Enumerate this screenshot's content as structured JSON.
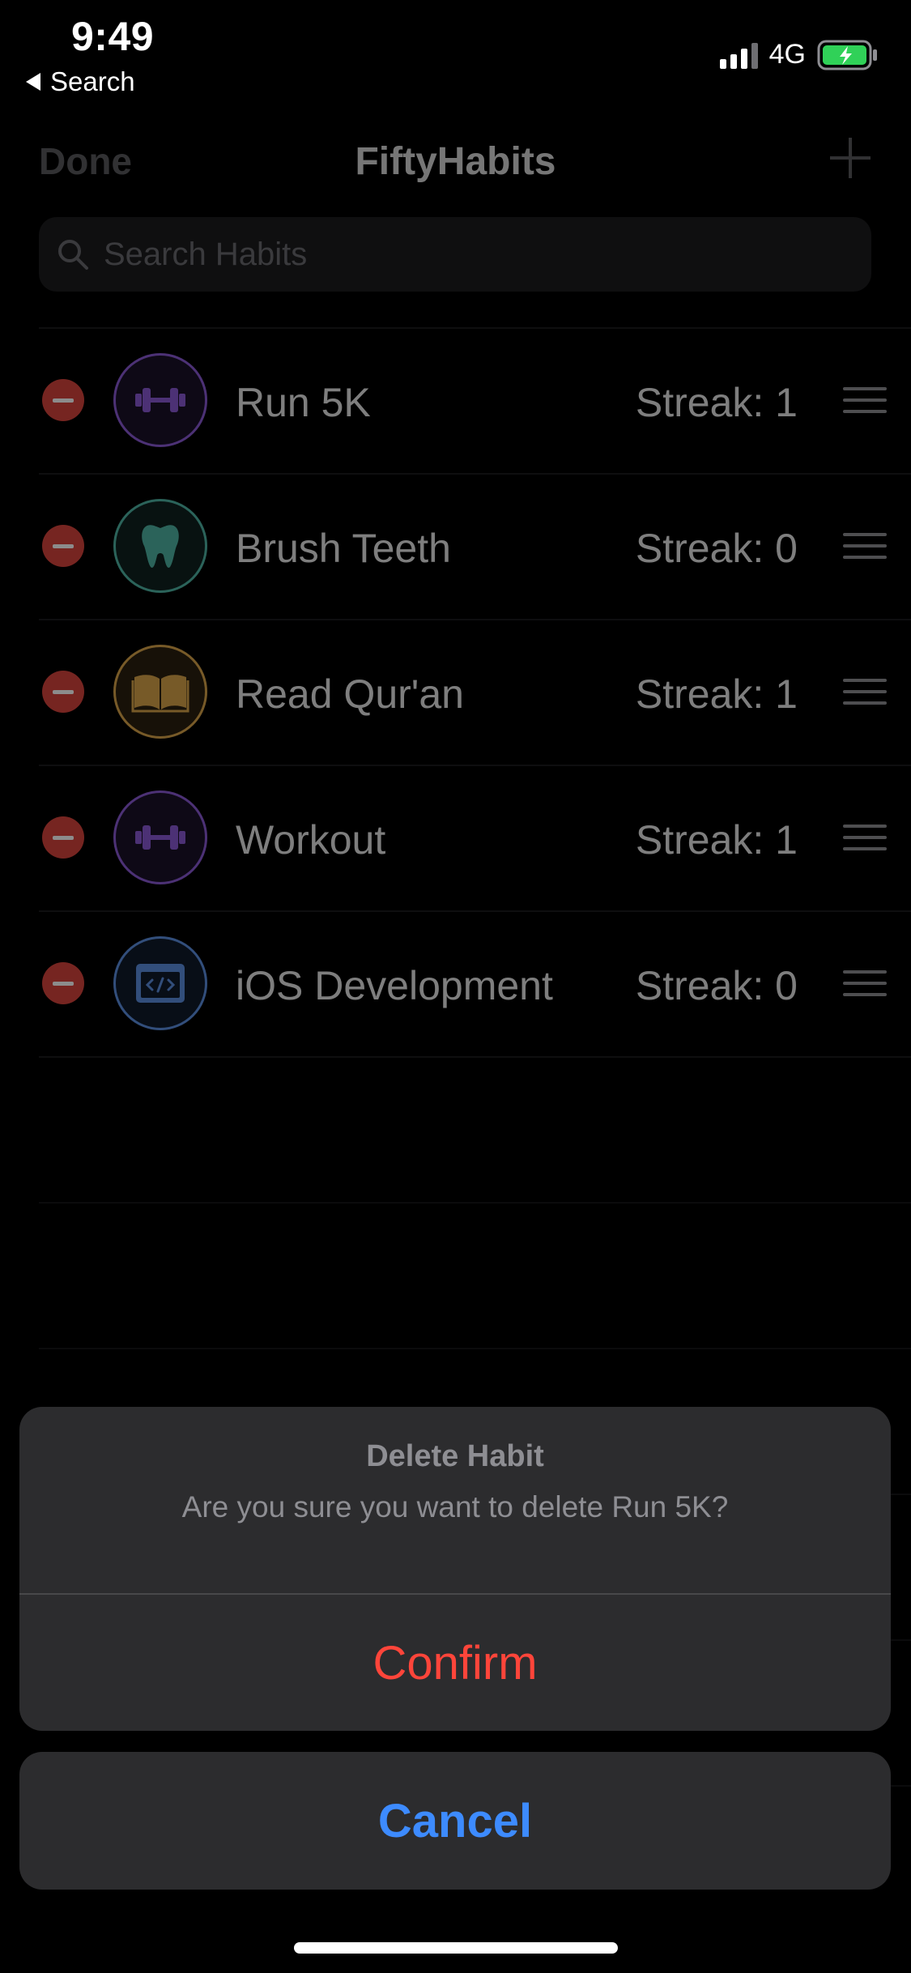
{
  "status_bar": {
    "time": "9:49",
    "back_label": "Search",
    "network": "4G"
  },
  "nav": {
    "done_label": "Done",
    "title": "FiftyHabits"
  },
  "search": {
    "placeholder": "Search Habits"
  },
  "habits": [
    {
      "name": "Run 5K",
      "streak": "Streak: 1",
      "icon": "dumbbell-icon",
      "color": "#8a5ad6"
    },
    {
      "name": "Brush Teeth",
      "streak": "Streak: 0",
      "icon": "tooth-icon",
      "color": "#4fb5a4"
    },
    {
      "name": "Read Qur'an",
      "streak": "Streak: 1",
      "icon": "book-icon",
      "color": "#d9a44a"
    },
    {
      "name": "Workout",
      "streak": "Streak: 1",
      "icon": "dumbbell-icon",
      "color": "#8a5ad6"
    },
    {
      "name": "iOS Development",
      "streak": "Streak: 0",
      "icon": "code-window-icon",
      "color": "#5b8ee0"
    }
  ],
  "action_sheet": {
    "title": "Delete Habit",
    "message": "Are you sure you want to delete Run 5K?",
    "confirm_label": "Confirm",
    "cancel_label": "Cancel"
  },
  "colors": {
    "destructive": "#ff453a",
    "accent": "#3d8bff",
    "delete_control": "#d8443c"
  }
}
